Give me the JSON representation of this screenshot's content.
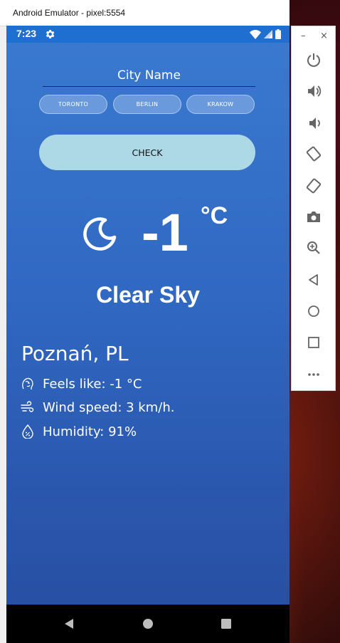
{
  "window": {
    "title": "Android Emulator - pixel:5554"
  },
  "statusbar": {
    "time": "7:23"
  },
  "search": {
    "placeholder": "City Name",
    "value": ""
  },
  "quick_cities": [
    {
      "label": "TORONTO"
    },
    {
      "label": "BERLIN"
    },
    {
      "label": "KRAKOW"
    }
  ],
  "actions": {
    "check_label": "CHECK"
  },
  "weather": {
    "icon": "moon-icon",
    "temperature": "-1",
    "unit": "°C",
    "condition": "Clear Sky",
    "location": "Poznań, PL",
    "feels_like": "Feels like: -1 °C",
    "wind_speed": "Wind speed: 3 km/h.",
    "humidity": "Humidity: 91%"
  },
  "side_toolbar": {
    "window_controls": {
      "minimize": "–",
      "close": "×"
    },
    "tools": [
      "power-icon",
      "volume-up-icon",
      "volume-down-icon",
      "rotate-left-icon",
      "rotate-right-icon",
      "camera-icon",
      "zoom-icon",
      "back-icon",
      "home-icon",
      "overview-icon",
      "more-icon"
    ]
  },
  "colors": {
    "statusbar": "#1e6fd0",
    "screen_top": "#3a79d0",
    "screen_bottom": "#2850a3",
    "check_button": "#add8e6",
    "navbar": "#000000"
  }
}
